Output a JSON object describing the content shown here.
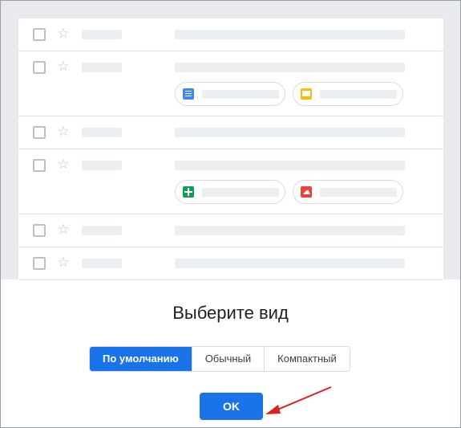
{
  "dialog": {
    "title": "Выберите вид",
    "options": [
      {
        "label": "По умолчанию",
        "selected": true
      },
      {
        "label": "Обычный",
        "selected": false
      },
      {
        "label": "Компактный",
        "selected": false
      }
    ],
    "ok_label": "OK"
  },
  "preview": {
    "rows": 6,
    "attachment_icons": [
      "docs-icon",
      "slides-icon",
      "sheets-icon",
      "photo-icon"
    ]
  },
  "colors": {
    "accent": "#1a73e8",
    "annotation_arrow": "#e02020",
    "backdrop": "#e8eaed"
  },
  "icons": {
    "star": "☆"
  }
}
